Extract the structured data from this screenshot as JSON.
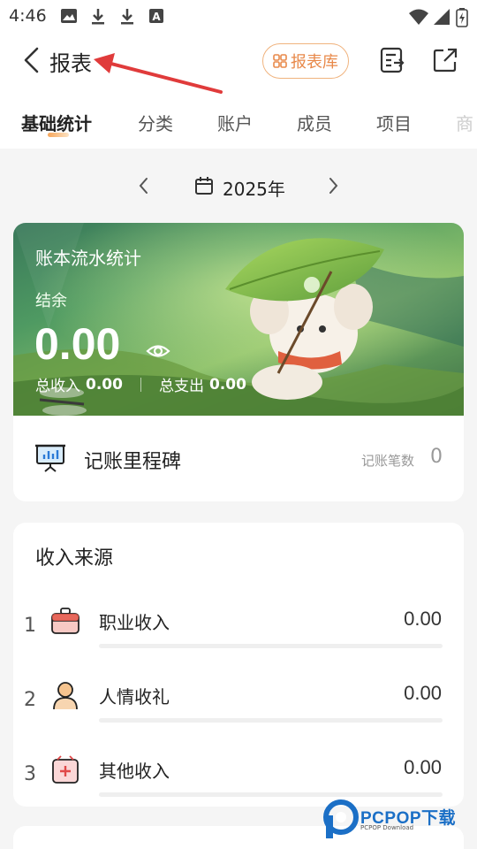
{
  "status_bar": {
    "time": "4:46",
    "icons": [
      "image-icon",
      "download-icon",
      "download-icon",
      "text-a-icon",
      "wifi-icon",
      "signal-icon",
      "battery-charging-icon"
    ]
  },
  "header": {
    "title": "报表",
    "report_library_button": "报表库",
    "icons": [
      "back-chevron-icon",
      "grid-icon",
      "export-list-icon",
      "share-out-icon"
    ]
  },
  "tabs": [
    {
      "label": "基础统计",
      "active": true
    },
    {
      "label": "分类",
      "active": false
    },
    {
      "label": "账户",
      "active": false
    },
    {
      "label": "成员",
      "active": false
    },
    {
      "label": "项目",
      "active": false
    },
    {
      "label": "商",
      "active": false
    }
  ],
  "year_nav": {
    "label": "2025年"
  },
  "banner": {
    "title": "账本流水统计",
    "balance_label": "结余",
    "balance_value": "0.00",
    "total_income_label": "总收入",
    "total_income_value": "0.00",
    "total_expense_label": "总支出",
    "total_expense_value": "0.00"
  },
  "milestone": {
    "label": "记账里程碑",
    "count_label": "记账笔数",
    "count_value": "0"
  },
  "income_sources": {
    "title": "收入来源",
    "rows": [
      {
        "rank": "1",
        "label": "职业收入",
        "value": "0.00",
        "icon": "briefcase-icon",
        "fill": 0
      },
      {
        "rank": "2",
        "label": "人情收礼",
        "value": "0.00",
        "icon": "person-icon",
        "fill": 0
      },
      {
        "rank": "3",
        "label": "其他收入",
        "value": "0.00",
        "icon": "plus-box-icon",
        "fill": 0
      }
    ]
  },
  "watermark": {
    "text": "PCPOP下载",
    "sub": "PCPOP Download"
  },
  "colors": {
    "accent_orange": "#e8894a",
    "annotation_red": "#e03b3b",
    "banner_green": "#4f9a62"
  }
}
